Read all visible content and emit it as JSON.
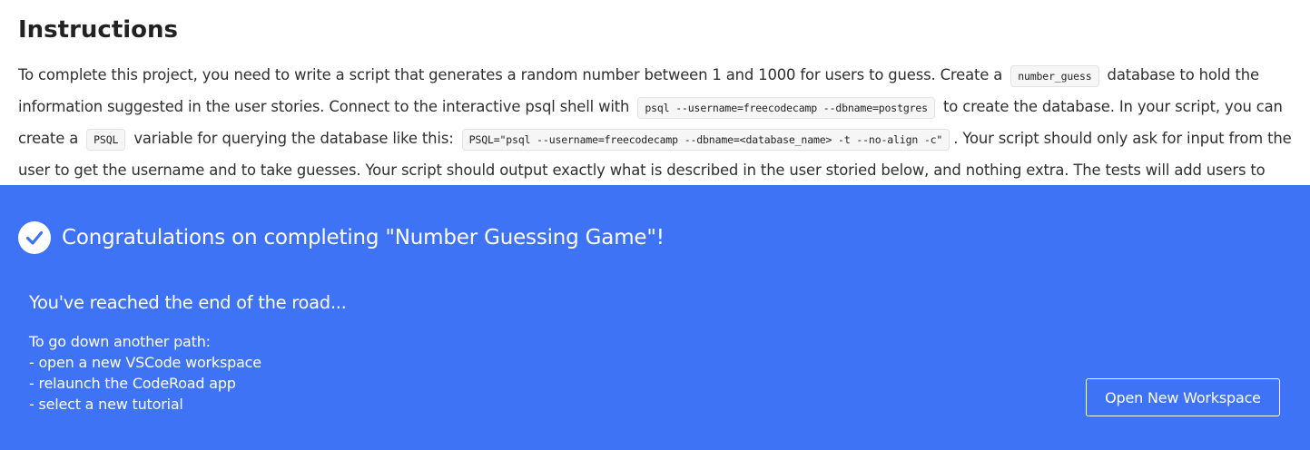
{
  "instructions": {
    "heading": "Instructions",
    "paragraph": [
      {
        "t": "text",
        "v": "To complete this project, you need to write a script that generates a random number between 1 and 1000 for users to guess. Create a "
      },
      {
        "t": "code",
        "v": "number_guess"
      },
      {
        "t": "text",
        "v": " database to hold the information suggested in the user stories. Connect to the interactive psql shell with "
      },
      {
        "t": "code",
        "v": "psql --username=freecodecamp --dbname=postgres"
      },
      {
        "t": "text",
        "v": " to create the database. In your script, you can create a "
      },
      {
        "t": "code",
        "v": "PSQL"
      },
      {
        "t": "text",
        "v": " variable for querying the database like this: "
      },
      {
        "t": "code",
        "v": "PSQL=\"psql --username=freecodecamp --dbname=<database_name> -t --no-align -c\""
      },
      {
        "t": "text",
        "v": ". Your script should only ask for input from the user to get the username and to take guesses. Your script should output exactly what is described in the user storied below, and nothing extra. The tests will add users to your database when the script has that ability, feel free to delete those. Some test involve the script running more than once until the script gets the chance. For information"
      }
    ]
  },
  "overlay": {
    "title": "Congratulations on completing \"Number Guessing Game\"!",
    "subtitle": "You've reached the end of the road...",
    "next_steps": [
      "To go down another path:",
      "- open a new VSCode workspace",
      "- relaunch the CodeRoad app",
      "- select a new tutorial"
    ],
    "button_label": "Open New Workspace",
    "icon": "check-circle-icon",
    "colors": {
      "banner_bg": "#3f73f6",
      "text": "#ffffff",
      "check": "#3f73f6"
    }
  }
}
